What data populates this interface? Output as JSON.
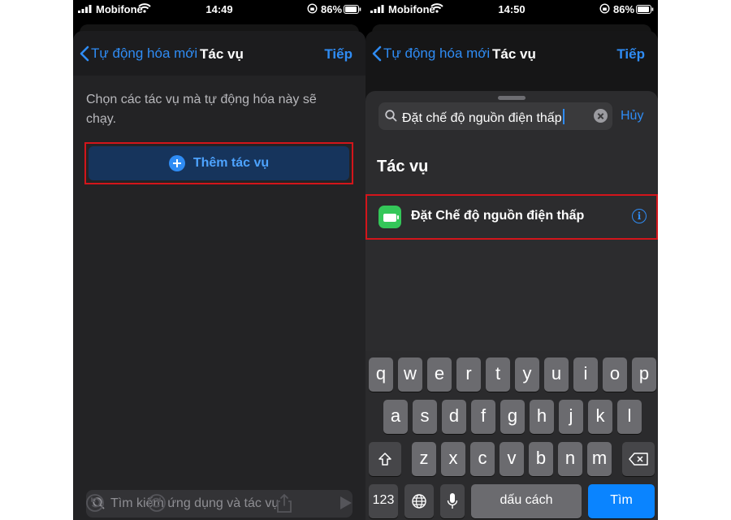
{
  "left": {
    "status": {
      "carrier": "Mobifone",
      "time": "14:49",
      "battery": "86%"
    },
    "nav": {
      "back_label": "Tự động hóa mới",
      "title": "Tác vụ",
      "next_label": "Tiếp"
    },
    "description": "Chọn các tác vụ mà tự động hóa này sẽ chạy.",
    "add_action_label": "Thêm tác vụ",
    "search_placeholder": "Tìm kiếm ứng dụng và tác vụ",
    "toolbar_icons": [
      "undo-icon",
      "redo-icon",
      "share-icon",
      "play-icon"
    ]
  },
  "right": {
    "status": {
      "carrier": "Mobifone",
      "time": "14:50",
      "battery": "86%"
    },
    "nav": {
      "back_label": "Tự động hóa mới",
      "title": "Tác vụ",
      "next_label": "Tiếp"
    },
    "search_value": "Đặt chế độ nguồn điện thấp",
    "cancel_label": "Hủy",
    "section_title": "Tác vụ",
    "result_label": "Đặt Chế độ nguồn điện thấp",
    "keyboard": {
      "row1": [
        "q",
        "w",
        "e",
        "r",
        "t",
        "y",
        "u",
        "i",
        "o",
        "p"
      ],
      "row2": [
        "a",
        "s",
        "d",
        "f",
        "g",
        "h",
        "j",
        "k",
        "l"
      ],
      "row3": [
        "z",
        "x",
        "c",
        "v",
        "b",
        "n",
        "m"
      ],
      "numbers_key": "123",
      "space_key": "dấu cách",
      "go_key": "Tìm"
    }
  },
  "colors": {
    "accent": "#2f8cf4",
    "highlight_border": "#d3151b",
    "action_green": "#34c759"
  }
}
